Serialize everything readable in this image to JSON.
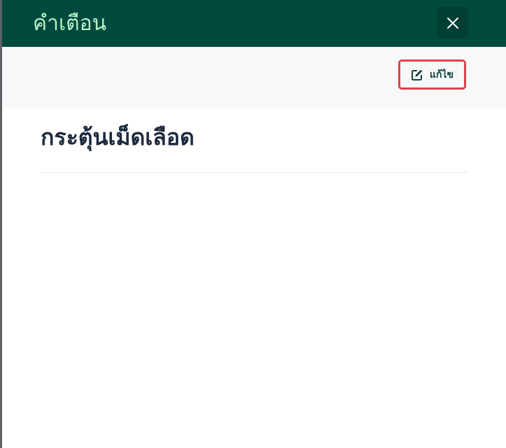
{
  "dialog": {
    "title": "คำเตือน",
    "close_icon": "close-icon"
  },
  "toolbar": {
    "edit_label": "แก้ไข",
    "edit_icon": "edit-icon"
  },
  "content": {
    "title": "กระตุ้นเม็ดเลือด"
  },
  "colors": {
    "header_bg": "#004a3d",
    "title_color": "#b5f0c6",
    "highlight_border": "#d9444a"
  }
}
